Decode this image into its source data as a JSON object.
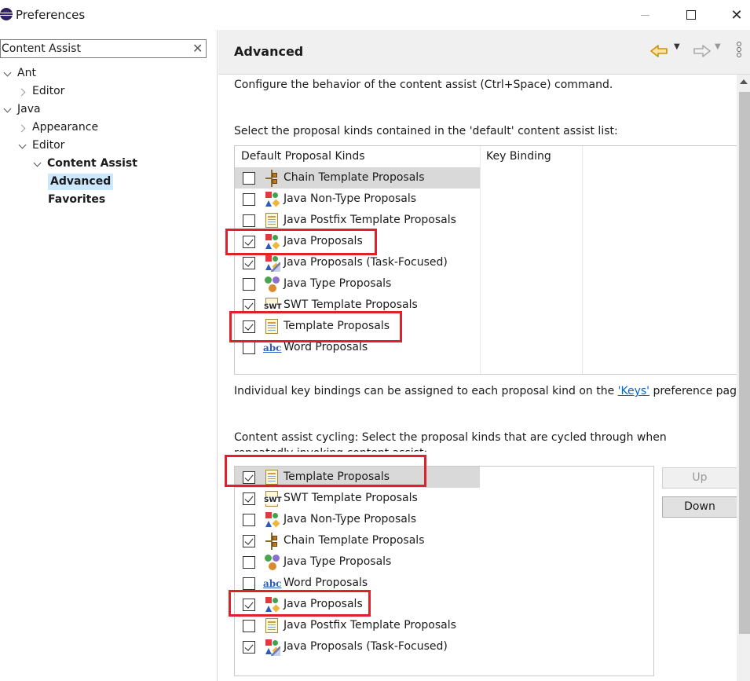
{
  "window": {
    "title": "Preferences",
    "controls": {
      "minimize": "—",
      "maximize": "□",
      "close": "✕"
    }
  },
  "sidebar": {
    "filter_value": "Content Assist",
    "filter_clear": "✕",
    "tree": [
      {
        "label": "Ant",
        "level": 0,
        "state": "open"
      },
      {
        "label": "Editor",
        "level": 1,
        "state": "closed"
      },
      {
        "label": "Java",
        "level": 0,
        "state": "open"
      },
      {
        "label": "Appearance",
        "level": 1,
        "state": "closed"
      },
      {
        "label": "Editor",
        "level": 1,
        "state": "open"
      },
      {
        "label": "Content Assist",
        "level": 2,
        "state": "open",
        "bold": true
      },
      {
        "label": "Advanced",
        "level": 3,
        "bold": true,
        "selected": true
      },
      {
        "label": "Favorites",
        "level": 3,
        "bold": true
      }
    ]
  },
  "page": {
    "title": "Advanced",
    "description": "Configure the behavior of the content assist (Ctrl+Space) command.",
    "default_list_label": "Select the proposal kinds contained in the 'default' content assist list:",
    "default_table": {
      "headers": [
        "Default Proposal Kinds",
        "Key Binding"
      ],
      "rows": [
        {
          "label": "Chain Template Proposals",
          "checked": false,
          "icon": "chain-template-icon",
          "selected": true
        },
        {
          "label": "Java Non-Type Proposals",
          "checked": false,
          "icon": "java-proposals-icon"
        },
        {
          "label": "Java Postfix Template Proposals",
          "checked": false,
          "icon": "template-icon"
        },
        {
          "label": "Java Proposals",
          "checked": true,
          "icon": "java-proposals-icon"
        },
        {
          "label": "Java Proposals (Task-Focused)",
          "checked": true,
          "icon": "java-task-focused-icon"
        },
        {
          "label": "Java Type Proposals",
          "checked": false,
          "icon": "java-type-icon"
        },
        {
          "label": "SWT Template Proposals",
          "checked": true,
          "icon": "swt-template-icon"
        },
        {
          "label": "Template Proposals",
          "checked": true,
          "icon": "template-icon"
        },
        {
          "label": "Word Proposals",
          "checked": false,
          "icon": "word-icon"
        }
      ]
    },
    "keys_note_before": "Individual key bindings can be assigned to each proposal kind on the ",
    "keys_link": "'Keys'",
    "keys_note_after": " preference page.",
    "cycling_label": "Content assist cycling: Select the proposal kinds that are cycled through when repeatedly invoking content assist:",
    "cycling_table": {
      "rows": [
        {
          "label": "Template Proposals",
          "checked": true,
          "icon": "template-icon",
          "selected": true
        },
        {
          "label": "SWT Template Proposals",
          "checked": true,
          "icon": "swt-template-icon"
        },
        {
          "label": "Java Non-Type Proposals",
          "checked": false,
          "icon": "java-proposals-icon"
        },
        {
          "label": "Chain Template Proposals",
          "checked": true,
          "icon": "chain-template-icon"
        },
        {
          "label": "Java Type Proposals",
          "checked": false,
          "icon": "java-type-icon"
        },
        {
          "label": "Word Proposals",
          "checked": false,
          "icon": "word-icon"
        },
        {
          "label": "Java Proposals",
          "checked": true,
          "icon": "java-proposals-icon"
        },
        {
          "label": "Java Postfix Template Proposals",
          "checked": false,
          "icon": "template-icon"
        },
        {
          "label": "Java Proposals (Task-Focused)",
          "checked": true,
          "icon": "java-task-focused-icon"
        }
      ]
    },
    "buttons": {
      "up": "Up",
      "down": "Down"
    },
    "word_icon_text": "abc"
  },
  "colors": {
    "annotation_red": "#e0202a",
    "link": "#0066cc",
    "selection": "#cce8ff"
  }
}
